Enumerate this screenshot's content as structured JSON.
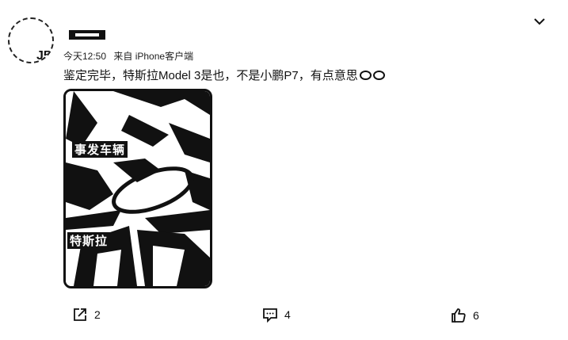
{
  "post": {
    "author_avatar_mark": "J5",
    "timestamp": "今天12:50",
    "source": "来自 iPhone客户端",
    "text": "鉴定完毕，特斯拉Model 3是也，不是小鹏P7，有点意思",
    "image": {
      "caption_top": "事发车辆",
      "caption_bottom": "特斯拉"
    }
  },
  "actions": {
    "share": {
      "icon": "share-icon",
      "count": "2"
    },
    "comment": {
      "icon": "comment-icon",
      "count": "4"
    },
    "like": {
      "icon": "thumbs-up-icon",
      "count": "6"
    }
  },
  "menu": {
    "icon": "chevron-down-icon"
  }
}
